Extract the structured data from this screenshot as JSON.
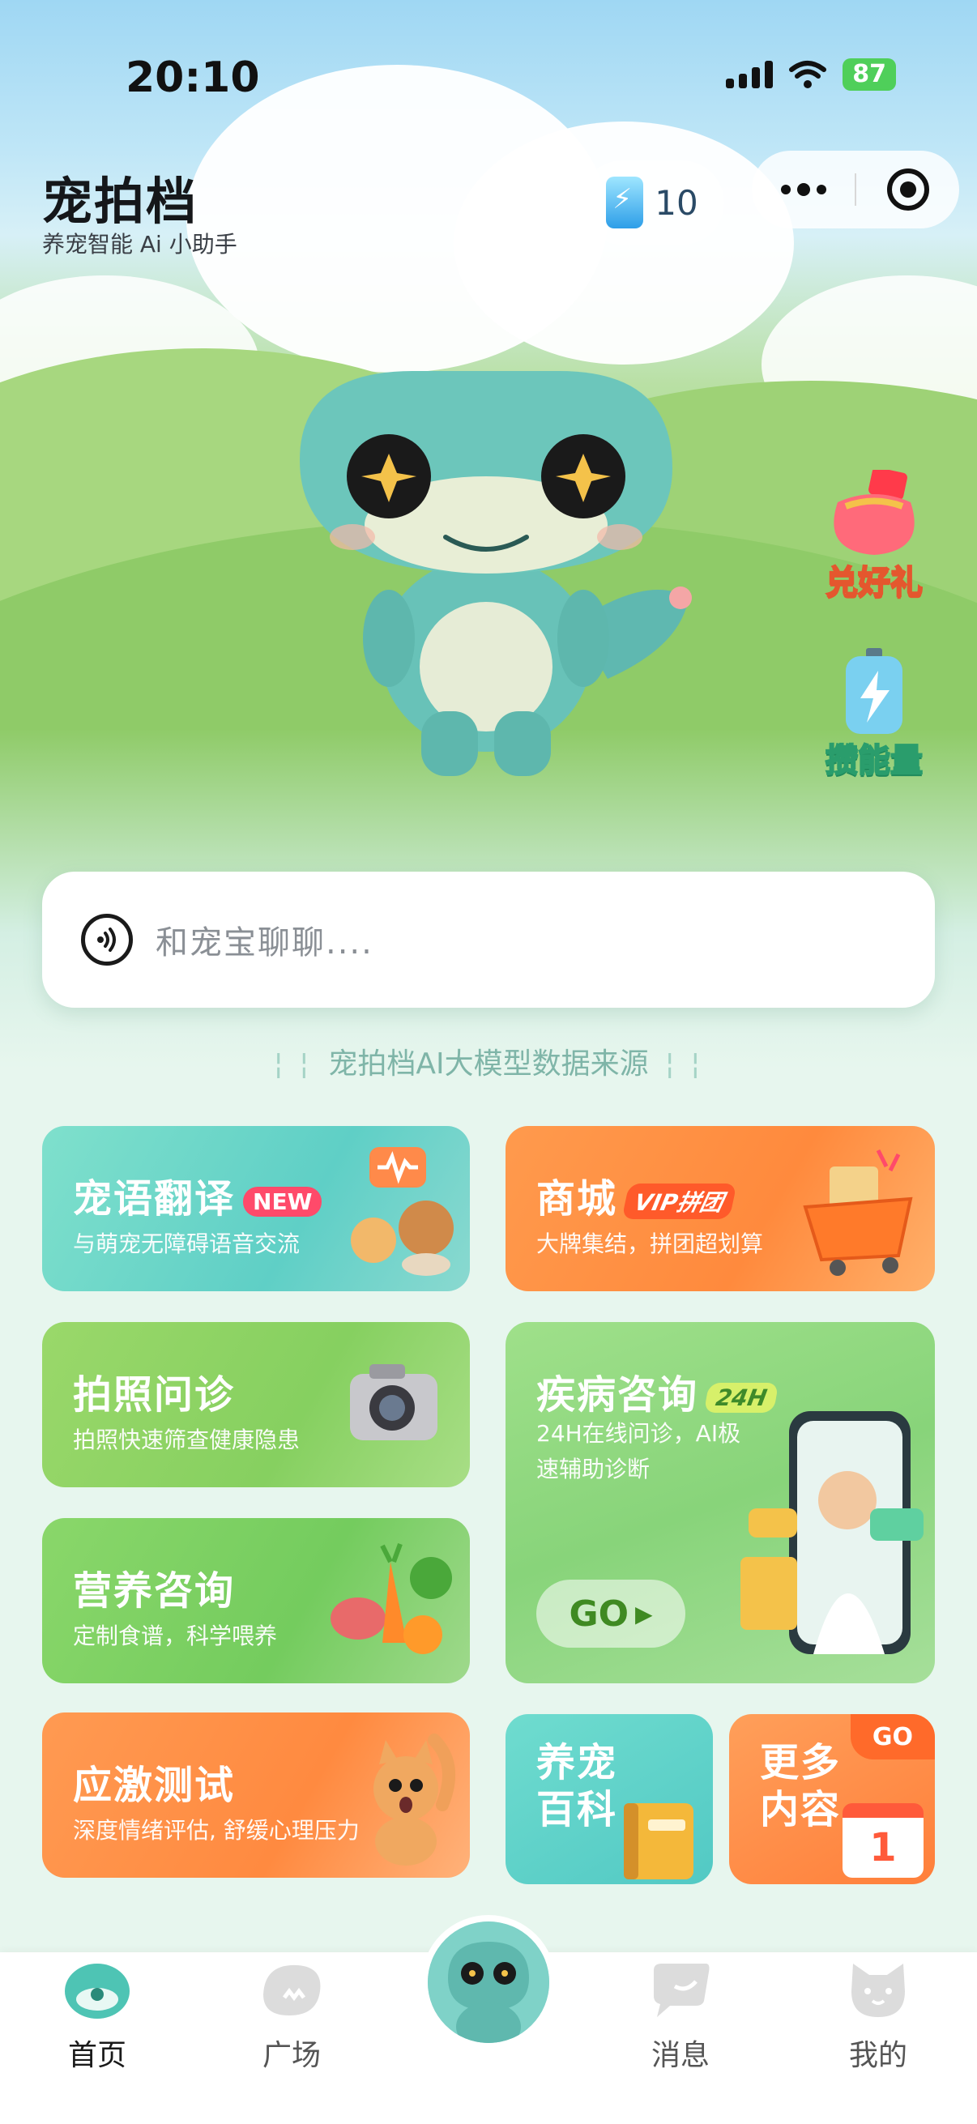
{
  "status_bar": {
    "time": "20:10",
    "battery": "87"
  },
  "header": {
    "title": "宠拍档",
    "subtitle": "养宠智能 Ai 小助手",
    "energy_count": "10",
    "capsule_icons": [
      "more-dots-icon",
      "target-close-icon"
    ]
  },
  "side_badges": [
    {
      "label": "兑好礼",
      "icon": "gift-bag-icon"
    },
    {
      "label": "攒能量",
      "icon": "energy-battery-icon"
    }
  ],
  "chat": {
    "placeholder": "和宠宝聊聊....",
    "icon": "voice-icon"
  },
  "source_note": "宠拍档AI大模型数据来源",
  "cards": {
    "translate": {
      "title": "宠语翻译",
      "tag": "NEW",
      "desc": "与萌宠无障碍语音交流"
    },
    "mall": {
      "title": "商城",
      "tag": "VIP拼团",
      "desc": "大牌集结，拼团超划算"
    },
    "photo": {
      "title": "拍照问诊",
      "desc": "拍照快速筛查健康隐患"
    },
    "disease": {
      "title": "疾病咨询",
      "tag": "24H",
      "desc_line1": "24H在线问诊，AI极",
      "desc_line2": "速辅助诊断",
      "go_label": "GO"
    },
    "nutrition": {
      "title": "营养咨询",
      "desc": "定制食谱，科学喂养"
    },
    "stress": {
      "title": "应激测试",
      "desc": "深度情绪评估, 舒缓心理压力"
    },
    "wiki": {
      "title_line1": "养宠",
      "title_line2": "百科"
    },
    "more": {
      "title_line1": "更多",
      "title_line2": "内容",
      "badge": "GO",
      "calendar_day": "1"
    }
  },
  "tabbar": {
    "items": [
      {
        "label": "首页",
        "icon": "home-icon",
        "active": true
      },
      {
        "label": "广场",
        "icon": "plaza-icon",
        "active": false
      },
      {
        "label": "",
        "icon": "mascot-center-icon",
        "active": false
      },
      {
        "label": "消息",
        "icon": "message-icon",
        "active": false
      },
      {
        "label": "我的",
        "icon": "profile-cat-icon",
        "active": false
      }
    ]
  },
  "colors": {
    "accent_teal": "#5fcfc6",
    "accent_orange": "#ff8a3d",
    "accent_green": "#86d060"
  }
}
